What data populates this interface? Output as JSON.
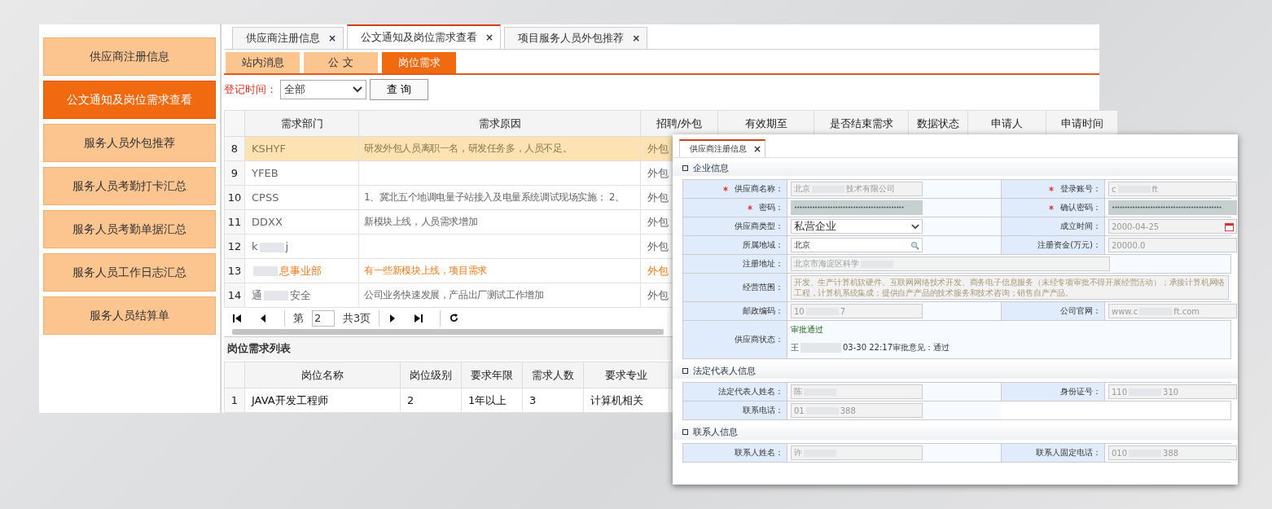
{
  "sidebar": {
    "items": [
      {
        "label": "供应商注册信息",
        "selected": false
      },
      {
        "label": "公文通知及岗位需求查看",
        "selected": true
      },
      {
        "label": "服务人员外包推荐",
        "selected": false
      },
      {
        "label": "服务人员考勤打卡汇总",
        "selected": false
      },
      {
        "label": "服务人员考勤单据汇总",
        "selected": false
      },
      {
        "label": "服务人员工作日志汇总",
        "selected": false
      },
      {
        "label": "服务人员结算单",
        "selected": false
      }
    ]
  },
  "tabs": [
    {
      "label": "供应商注册信息",
      "close": "×",
      "selected": false
    },
    {
      "label": "公文通知及岗位需求查看",
      "close": "×",
      "selected": true
    },
    {
      "label": "项目服务人员外包推荐",
      "close": "×",
      "selected": false
    }
  ],
  "subtabs": [
    {
      "label": "站内消息",
      "selected": false
    },
    {
      "label": "公 文",
      "selected": false
    },
    {
      "label": "岗位需求",
      "selected": true
    }
  ],
  "filter": {
    "label": "登记时间：",
    "value": "全部",
    "button": "查 询"
  },
  "table": {
    "columns": [
      "需求部门",
      "需求原因",
      "招聘/外包",
      "有效期至",
      "是否结束需求",
      "数据状态",
      "申请人",
      "申请时间"
    ],
    "rows": [
      {
        "index": "8",
        "selected": true,
        "highlight": false,
        "dept": [
          "KSHYF"
        ],
        "reason": "研发外包人员离职一名，研发任务多，人员不足。",
        "type": "外包"
      },
      {
        "index": "9",
        "selected": false,
        "highlight": false,
        "dept": [
          "YFEB"
        ],
        "type": "外包"
      },
      {
        "index": "10",
        "selected": false,
        "highlight": false,
        "dept": [
          "CPSS"
        ],
        "reason": "1、冀北五个地调电量子站接入及电量系统调试现场实施； 2、",
        "type": "外包"
      },
      {
        "index": "11",
        "selected": false,
        "highlight": false,
        "dept": [
          "DDXX"
        ],
        "reason": "新模块上线，人员需求增加",
        "type": "外包"
      },
      {
        "index": "12",
        "selected": false,
        "highlight": false,
        "dept": [
          "k",
          "j"
        ],
        "type": "外包"
      },
      {
        "index": "13",
        "selected": false,
        "highlight": true,
        "dept": [
          "息事业部"
        ],
        "blur_lead": true,
        "reason": "有一些新模块上线，项目需求",
        "type": "外包"
      },
      {
        "index": "14",
        "selected": false,
        "highlight": false,
        "dept": [
          "通",
          "安全"
        ],
        "reason": "公司业务快速发展，产品出厂测试工作增加",
        "type": "外包"
      }
    ]
  },
  "pager": {
    "page_prefix": "第",
    "page": "2",
    "page_total": "共3页"
  },
  "positions": {
    "title": "岗位需求列表",
    "columns": [
      "岗位名称",
      "岗位级别",
      "要求年限",
      "需求人数",
      "要求专业"
    ],
    "rows": [
      {
        "index": "1",
        "cells": [
          "JAVA开发工程师",
          "2",
          "1年以上",
          "3",
          "计算机相关"
        ]
      }
    ]
  },
  "popup": {
    "tab": {
      "label": "供应商注册信息",
      "close": "×"
    },
    "sections": [
      {
        "title": "企业信息",
        "rows": [
          {
            "kind": "pair",
            "fields": [
              {
                "label": "供应商名称：",
                "required": true,
                "kind": "text",
                "value": [
                  "北京",
                  "技术有限公司"
                ]
              },
              {
                "label": "登录账号：",
                "required": true,
                "kind": "text",
                "value": [
                  "c",
                  "ft"
                ]
              }
            ]
          },
          {
            "kind": "pair",
            "fields": [
              {
                "label": "密码：",
                "required": true,
                "kind": "password",
                "value": [
                  "•••••••••••••••••••••••••••••••••••••••••••"
                ]
              },
              {
                "label": "确认密码：",
                "required": true,
                "kind": "password",
                "value": [
                  "•••••••••••••••••••••••••••••••••••••••••••"
                ]
              }
            ]
          },
          {
            "kind": "pair",
            "fields": [
              {
                "label": "供应商类型：",
                "required": false,
                "kind": "select",
                "value": [
                  "私营企业"
                ]
              },
              {
                "label": "成立时间：",
                "required": false,
                "kind": "date",
                "value": [
                  "2000-04-25"
                ]
              }
            ]
          },
          {
            "kind": "pair",
            "fields": [
              {
                "label": "所属地域：",
                "required": false,
                "kind": "search",
                "value": [
                  "北京"
                ]
              },
              {
                "label": "注册资金(万元)：",
                "required": false,
                "kind": "text",
                "value": [
                  "20000.0"
                ]
              }
            ]
          },
          {
            "kind": "wide",
            "fields": [
              {
                "label": "注册地址：",
                "required": false,
                "kind": "text",
                "value": [
                  "北京市海淀区科学"
                ],
                "blur_tail": true
              }
            ]
          },
          {
            "kind": "textarea",
            "fields": [
              {
                "label": "经营范围：",
                "required": false,
                "kind": "textarea",
                "value": [
                  "开发、生产计算机软硬件、互联网网络技术开发、商务电子信息服务（未经专项审批不得开展经营活动）；承接计算机网络工程，计算机系统集成；提供自产产品的技术服务和技术咨询；销售自产产品。"
                ]
              }
            ]
          },
          {
            "kind": "pair",
            "fields": [
              {
                "label": "邮政编码：",
                "required": false,
                "kind": "text",
                "value": [
                  "10",
                  "7"
                ]
              },
              {
                "label": "公司官网：",
                "required": false,
                "kind": "text",
                "value": [
                  "www.c",
                  "ft.com"
                ]
              }
            ]
          },
          {
            "kind": "status",
            "fields": [
              {
                "label": "供应商状态：",
                "required": false,
                "kind": "status",
                "status": "审批通过",
                "value": [
                  "王",
                  "03-30 22:17审批意见：通过"
                ]
              }
            ]
          }
        ]
      },
      {
        "title": "法定代表人信息",
        "rows": [
          {
            "kind": "pair",
            "fields": [
              {
                "label": "法定代表人姓名：",
                "required": false,
                "kind": "text",
                "value": [
                  "陈"
                ],
                "blur_tail": true
              },
              {
                "label": "身份证号：",
                "required": false,
                "kind": "text",
                "value": [
                  "110",
                  "310"
                ]
              }
            ]
          },
          {
            "kind": "pair",
            "fields": [
              {
                "label": "联系电话：",
                "required": false,
                "kind": "text",
                "value": [
                  "01",
                  "388"
                ]
              }
            ]
          }
        ]
      },
      {
        "title": "联系人信息",
        "rows": [
          {
            "kind": "pair",
            "fields": [
              {
                "label": "联系人姓名：",
                "required": false,
                "kind": "text",
                "value": [
                  "许"
                ],
                "blur_tail": true
              },
              {
                "label": "联系人固定电话：",
                "required": false,
                "kind": "text",
                "value": [
                  "010",
                  "388"
                ]
              }
            ]
          }
        ]
      }
    ]
  }
}
